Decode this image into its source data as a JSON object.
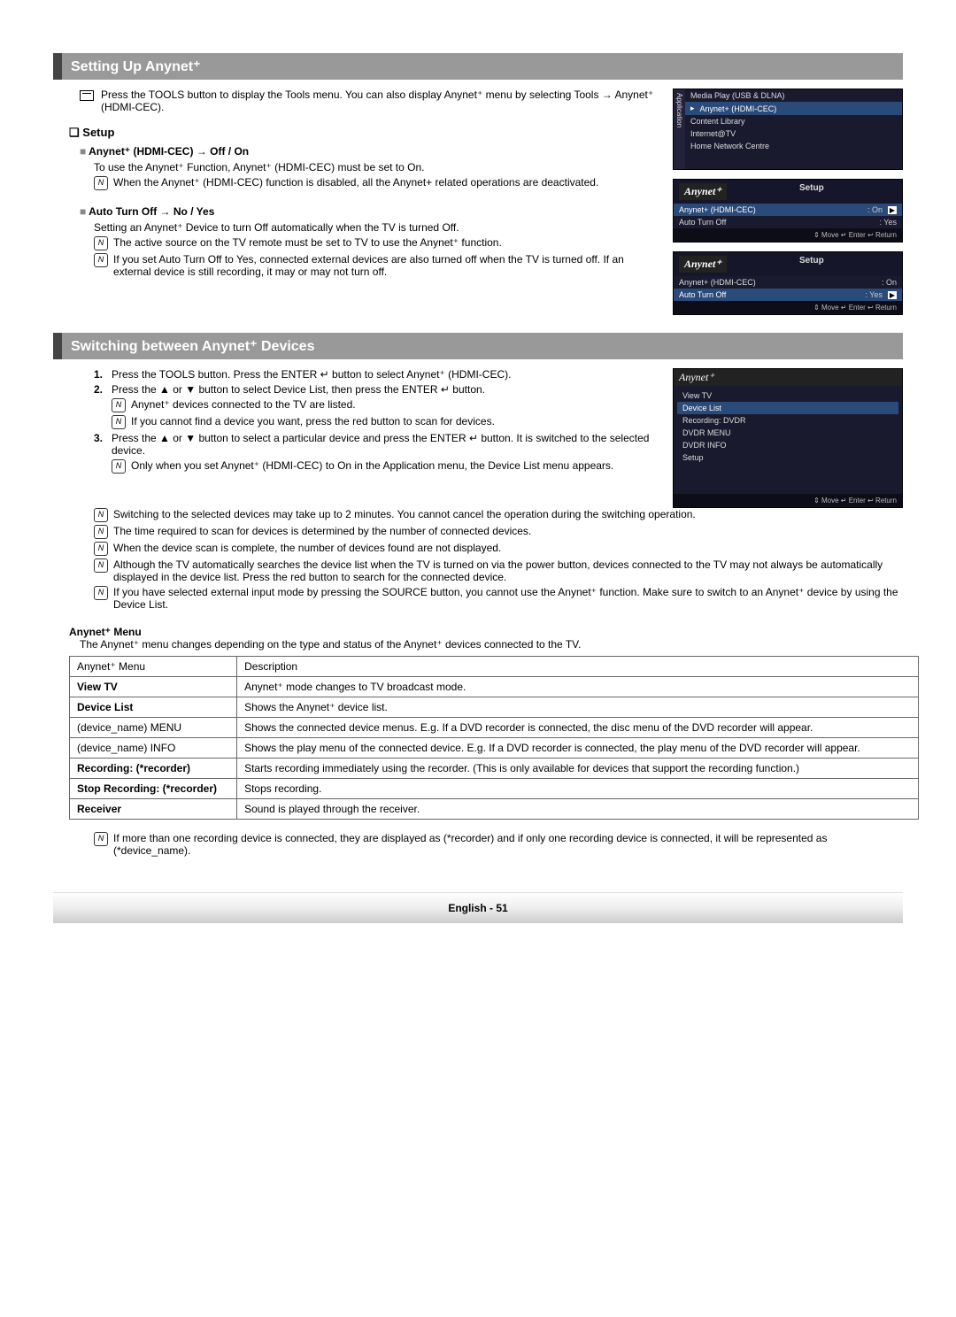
{
  "section1": {
    "title": "Setting Up Anynet⁺",
    "intro": "Press the TOOLS button to display the Tools menu. You can also display Anynet⁺ menu by selecting Tools → Anynet⁺ (HDMI-CEC).",
    "setup_heading": "Setup",
    "item1_title": "Anynet⁺ (HDMI-CEC) → Off / On",
    "item1_body": "To use the Anynet⁺ Function, Anynet⁺ (HDMI-CEC) must be set to On.",
    "item1_note": "When the Anynet⁺ (HDMI-CEC) function is disabled, all the Anynet+ related operations are deactivated.",
    "item2_title": "Auto Turn Off → No / Yes",
    "item2_body": "Setting an Anynet⁺ Device to turn Off automatically when the TV is turned Off.",
    "item2_note1": "The active source on the TV remote must be set to TV to use the Anynet⁺ function.",
    "item2_note2": "If you set Auto Turn Off to Yes, connected external devices are also turned off when the TV is turned off. If an external device is still recording, it may or may not turn off."
  },
  "section2": {
    "title": "Switching between Anynet⁺ Devices",
    "step1": "Press the TOOLS button. Press the ENTER ↵ button to select Anynet⁺ (HDMI-CEC).",
    "step2": "Press the ▲ or ▼ button to select Device List, then press the ENTER ↵ button.",
    "step2_note1": "Anynet⁺ devices connected to the TV are listed.",
    "step2_note2": "If you cannot find a device you want, press the red button to scan for devices.",
    "step3": "Press the ▲ or ▼ button to select a particular device and press the ENTER ↵ button. It is switched to the selected device.",
    "step3_note": "Only when you set Anynet⁺ (HDMI-CEC) to On in the Application menu, the Device List menu appears.",
    "n1": "Switching to the selected devices may take up to 2 minutes. You cannot cancel the operation during the switching operation.",
    "n2": "The time required to scan for devices is determined by the number of connected devices.",
    "n3": "When the device scan is complete, the number of devices found are not displayed.",
    "n4": "Although the TV automatically searches the device list when the TV is turned on via the power button, devices connected to the TV may not always be automatically displayed in the device list. Press the red button to search for the connected device.",
    "n5": "If you have selected external input mode by pressing the SOURCE button, you cannot use the Anynet⁺ function. Make sure to switch to an Anynet⁺ device by using the Device List."
  },
  "menu": {
    "heading": "Anynet⁺ Menu",
    "intro": "The Anynet⁺ menu changes depending on the type and status of the Anynet⁺ devices connected to the TV.",
    "h1": "Anynet⁺ Menu",
    "h2": "Description",
    "r1a": "View TV",
    "r1b": "Anynet⁺ mode changes to TV broadcast mode.",
    "r2a": "Device List",
    "r2b": "Shows the Anynet⁺ device list.",
    "r3a": "(device_name) MENU",
    "r3b": "Shows the connected device menus. E.g. If a DVD recorder is connected, the disc menu of the DVD recorder will appear.",
    "r4a": "(device_name) INFO",
    "r4b": "Shows the play menu of the connected device. E.g. If a DVD recorder is connected, the play menu of the DVD recorder will appear.",
    "r5a": "Recording: (*recorder)",
    "r5b": "Starts recording immediately using the recorder. (This is only available for devices that support the recording function.)",
    "r6a": "Stop Recording: (*recorder)",
    "r6b": "Stops recording.",
    "r7a": "Receiver",
    "r7b": "Sound is played through the receiver.",
    "footnote": "If more than one recording device is connected, they are displayed as (*recorder) and if only one recording device is connected, it will be represented as (*device_name)."
  },
  "shots": {
    "app_tab": "Application",
    "app_items": [
      "Media Play (USB & DLNA)",
      "Anynet+ (HDMI-CEC)",
      "Content Library",
      "Internet@TV",
      "Home Network Centre"
    ],
    "brand": "Anynet⁺",
    "setup_title": "Setup",
    "row_cec": "Anynet+ (HDMI-CEC)",
    "row_cec_val": ": On",
    "row_auto": "Auto Turn Off",
    "row_auto_val": ": Yes",
    "foot": "⇕ Move    ↵ Enter    ↩ Return",
    "devlist": [
      "View TV",
      "Device List",
      "Recording: DVDR",
      "DVDR MENU",
      "DVDR INFO",
      "Setup"
    ]
  },
  "footer": "English - 51"
}
